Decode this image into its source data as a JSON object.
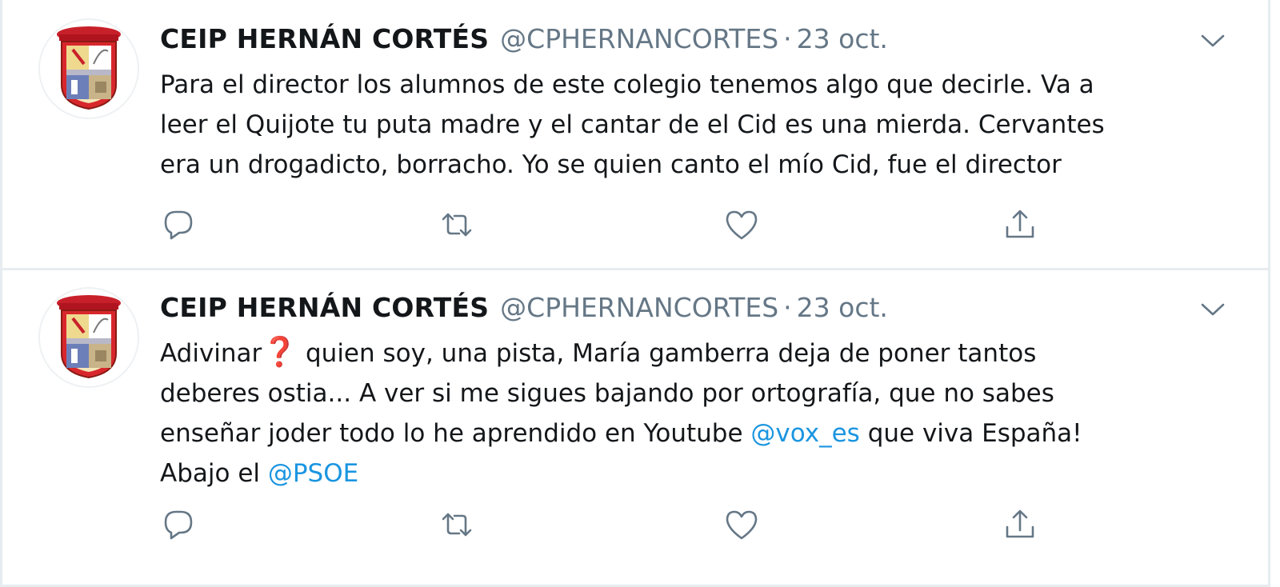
{
  "colors": {
    "text": "#14171a",
    "secondary": "#657786",
    "mention": "#1b95e0",
    "divider": "#e6ecf0",
    "icon": "#657786"
  },
  "tweets": [
    {
      "name": "CEIP HERNÁN CORTÉS",
      "handle": "@CPHERNANCORTES",
      "dot": "·",
      "date": "23 oct.",
      "lines": [
        "Para el director los alumnos de este colegio tenemos algo que decirle. Va a",
        "leer el Quijote tu puta madre y el cantar de el Cid es una mierda. Cervantes",
        "era un drogadicto, borracho. Yo se quien canto el mío Cid, fue el director"
      ],
      "icons": [
        "reply-icon",
        "retweet-icon",
        "like-icon",
        "share-icon"
      ]
    },
    {
      "name": "CEIP HERNÁN CORTÉS",
      "handle": "@CPHERNANCORTES",
      "dot": "·",
      "date": "23 oct.",
      "line1_a": "Adivinar",
      "line1_emoji": "❓",
      "line1_b": " quien soy, una pista, María gamberra deja de poner tantos",
      "line2": "deberes ostia... A ver si me sigues bajando por ortografía, que no sabes",
      "line3_a": "enseñar joder todo lo he aprendido en Youtube ",
      "mention1": "@vox_es",
      "line3_b": " que viva España!",
      "line4_a": "Abajo el ",
      "mention2": "@PSOE",
      "icons": [
        "reply-icon",
        "retweet-icon",
        "like-icon",
        "share-icon"
      ]
    }
  ]
}
